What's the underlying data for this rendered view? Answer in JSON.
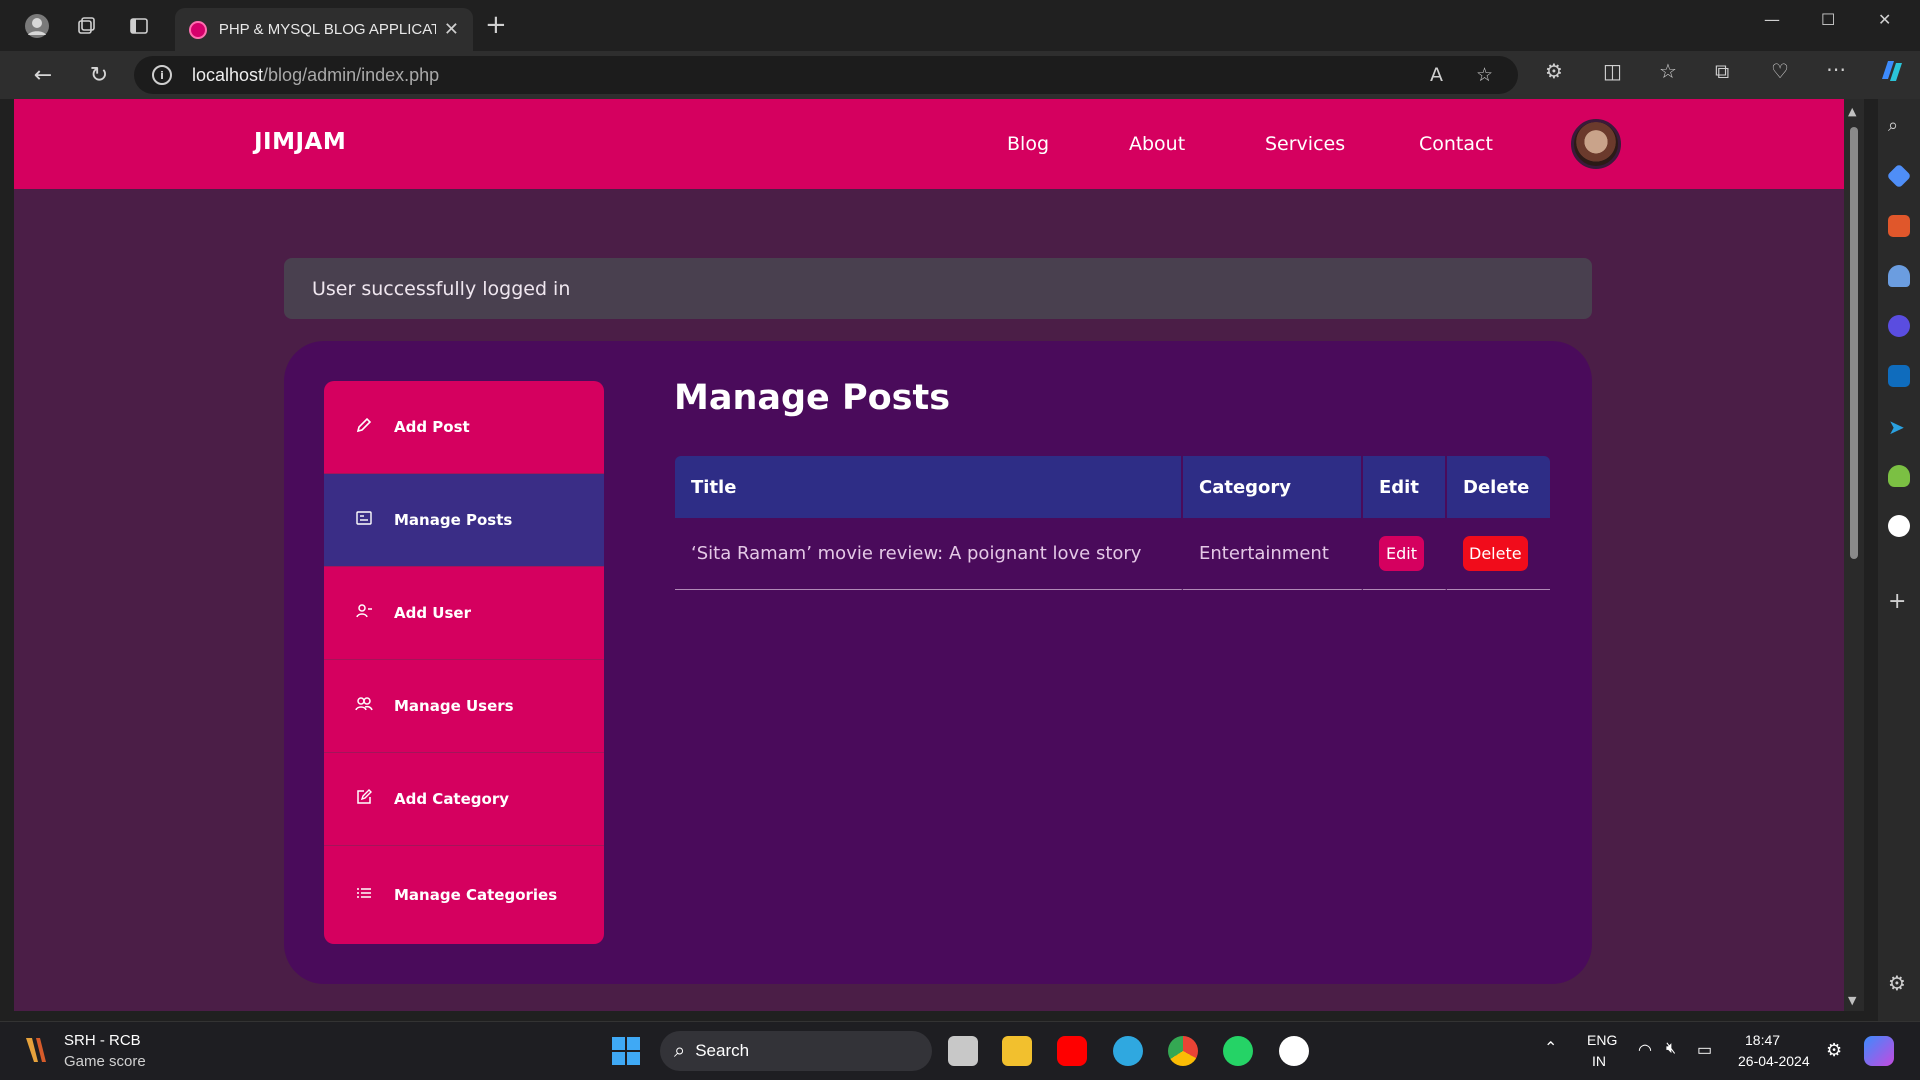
{
  "browser": {
    "tab_title": "PHP & MYSQL BLOG APPLICATIC",
    "url_host": "localhost",
    "url_path": "/blog/admin/index.php"
  },
  "site": {
    "brand": "JIMJAM",
    "nav": [
      "Blog",
      "About",
      "Services",
      "Contact"
    ]
  },
  "alert": {
    "message": "User successfully logged in"
  },
  "sidebar": {
    "items": [
      {
        "label": "Add Post",
        "icon": "pencil-icon"
      },
      {
        "label": "Manage Posts",
        "icon": "posts-icon",
        "active": true
      },
      {
        "label": "Add User",
        "icon": "add-user-icon"
      },
      {
        "label": "Manage Users",
        "icon": "users-icon"
      },
      {
        "label": "Add Category",
        "icon": "edit-box-icon"
      },
      {
        "label": "Manage Categories",
        "icon": "list-icon"
      }
    ]
  },
  "main": {
    "title": "Manage Posts",
    "table": {
      "headers": [
        "Title",
        "Category",
        "Edit",
        "Delete"
      ],
      "rows": [
        {
          "title": "‘Sita Ramam’ movie review: A poignant love story",
          "category": "Entertainment",
          "edit": "Edit",
          "delete": "Delete"
        }
      ]
    }
  },
  "taskbar": {
    "widget_title": "SRH - RCB",
    "widget_sub": "Game score",
    "search_placeholder": "Search",
    "lang_top": "ENG",
    "lang_bottom": "IN",
    "time": "18:47",
    "date": "26-04-2024"
  },
  "colors": {
    "navbar": "#d5005f",
    "page_bg": "#4b1e47",
    "panel_bg": "#4a0b5b",
    "active_item": "#3a2d86",
    "delete_btn": "#f10c1b"
  }
}
